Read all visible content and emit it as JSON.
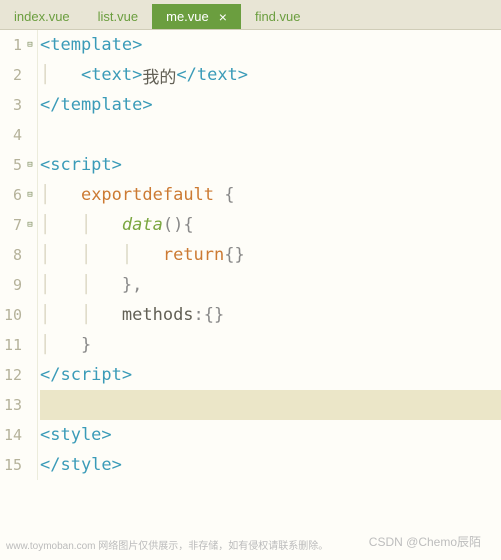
{
  "tabs": [
    {
      "label": "index.vue",
      "active": false
    },
    {
      "label": "list.vue",
      "active": false
    },
    {
      "label": "me.vue",
      "active": true,
      "close": "×"
    },
    {
      "label": "find.vue",
      "active": false
    }
  ],
  "lines": [
    {
      "n": "1",
      "fold": "⊟"
    },
    {
      "n": "2",
      "fold": ""
    },
    {
      "n": "3",
      "fold": ""
    },
    {
      "n": "4",
      "fold": ""
    },
    {
      "n": "5",
      "fold": "⊟"
    },
    {
      "n": "6",
      "fold": "⊟"
    },
    {
      "n": "7",
      "fold": "⊟"
    },
    {
      "n": "8",
      "fold": ""
    },
    {
      "n": "9",
      "fold": ""
    },
    {
      "n": "10",
      "fold": ""
    },
    {
      "n": "11",
      "fold": ""
    },
    {
      "n": "12",
      "fold": ""
    },
    {
      "n": "13",
      "fold": "",
      "hl": true
    },
    {
      "n": "14",
      "fold": ""
    },
    {
      "n": "15",
      "fold": ""
    }
  ],
  "code": {
    "l1_open": "<template>",
    "l2_open": "<text>",
    "l2_text": "我的",
    "l2_close": "</text>",
    "l3": "</template>",
    "l5": "<script>",
    "l6_kw1": "export",
    "l6_kw2": "default",
    "l6_p": " {",
    "l7_fn": "data",
    "l7_p": "(){",
    "l8_kw": "return",
    "l8_p": "{}",
    "l9": "},",
    "l10_k": "methods",
    "l10_p": ":{}",
    "l11": "}",
    "l12": "</script>",
    "l14": "<style>",
    "l15": "</style>"
  },
  "watermark1": "www.toymoban.com 网络图片仅供展示，非存储，如有侵权请联系删除。",
  "watermark2": "CSDN @Chemo辰陌"
}
